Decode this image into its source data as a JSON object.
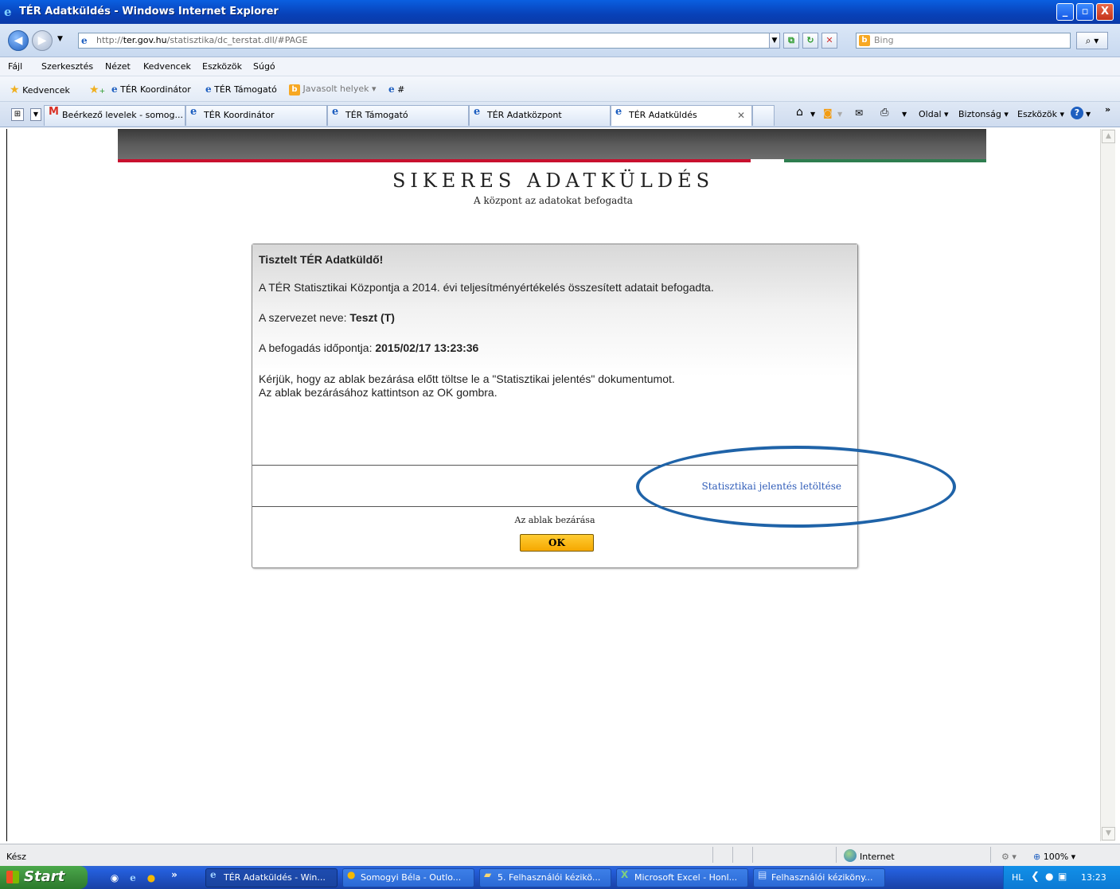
{
  "window": {
    "title": "TÉR Adatküldés - Windows Internet Explorer",
    "minimize": "_",
    "maximize": "▫",
    "close": "X"
  },
  "address": {
    "prefix": "http://",
    "host": "ter.gov.hu",
    "path": "/statisztika/dc_terstat.dll/#PAGE",
    "search_placeholder": "Bing"
  },
  "menu": [
    "Fájl",
    "Szerkesztés",
    "Nézet",
    "Kedvencek",
    "Eszközök",
    "Súgó"
  ],
  "favorites": {
    "label": "Kedvencek",
    "items": [
      "TÉR Koordinátor",
      "TÉR Támogató",
      "Javasolt helyek ▾",
      "#"
    ]
  },
  "tabs": [
    {
      "label": "Beérkező levelek - somog..."
    },
    {
      "label": "TÉR Koordinátor"
    },
    {
      "label": "TÉR Támogató"
    },
    {
      "label": "TÉR Adatközpont"
    },
    {
      "label": "TÉR Adatküldés"
    }
  ],
  "tab_tools": {
    "page": "Oldal ▾",
    "safety": "Biztonság ▾",
    "tools": "Eszközök ▾",
    "more": "»"
  },
  "page": {
    "heading": "SIKERES ADATKÜLDÉS",
    "subheading": "A központ az adatokat befogadta",
    "greeting": "Tisztelt TÉR Adatküldő!",
    "message": "A TÉR Statisztikai Központja a 2014. évi teljesítményértékelés összesített adatait befogadta.",
    "org_label": "A szervezet neve: ",
    "org_value": "Teszt (T)",
    "time_label": "A befogadás időpontja: ",
    "time_value": "2015/02/17 13:23:36",
    "instruction1": "Kérjük, hogy az ablak bezárása előtt töltse le a \"Statisztikai jelentés\" dokumentumot.",
    "instruction2": "Az ablak bezárásához kattintson az OK gombra.",
    "download_link": "Statisztikai jelentés letöltése",
    "close_label": "Az ablak bezárása",
    "ok_button": "OK"
  },
  "status": {
    "left": "Kész",
    "zone": "Internet",
    "zoom": "100%"
  },
  "taskbar": {
    "start": "Start",
    "tasks": [
      "TÉR Adatküldés - Win...",
      "Somogyi Béla - Outlo...",
      "5. Felhasználói kézikö...",
      "Microsoft Excel - Honl...",
      "Felhasználói kéziköny..."
    ],
    "lang": "HL",
    "clock": "13:23"
  },
  "colors": {
    "link": "#2f5cb8",
    "ok_button": "#f5a800",
    "annotation_ellipse": "#1f63a8"
  }
}
